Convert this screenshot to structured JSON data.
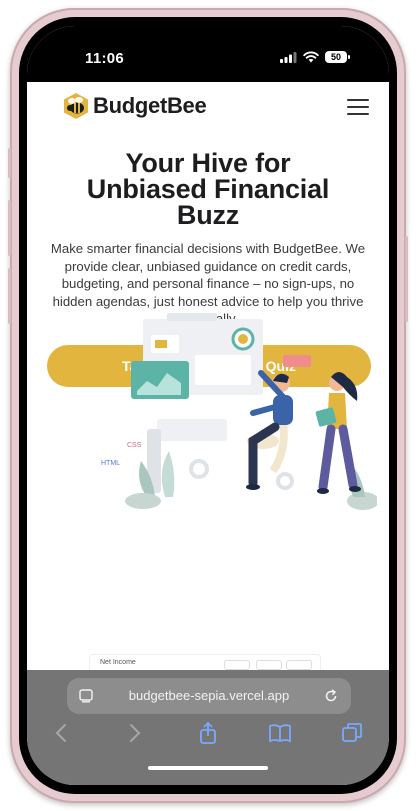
{
  "status_bar": {
    "time": "11:06",
    "battery": "50"
  },
  "header": {
    "brand": "BudgetBee"
  },
  "hero": {
    "title_line1": "Your Hive for",
    "title_line2": "Unbiased Financial",
    "title_line3": "Buzz",
    "subtitle": "Make smarter financial decisions with BudgetBee. We provide clear, unbiased guidance on credit cards, budgeting, and personal finance – no sign-ups, no hidden agendas, just honest advice to help you thrive financially.",
    "cta_label": "Take Our Credit Card Quiz"
  },
  "illustration": {
    "tag_css": "CSS",
    "tag_html": "HTML"
  },
  "peek": {
    "label": "Net Income"
  },
  "browser": {
    "url": "budgetbee-sepia.vercel.app"
  },
  "colors": {
    "accent": "#e2b53f",
    "teal": "#5bb4a6",
    "text": "#1d1d1f"
  }
}
